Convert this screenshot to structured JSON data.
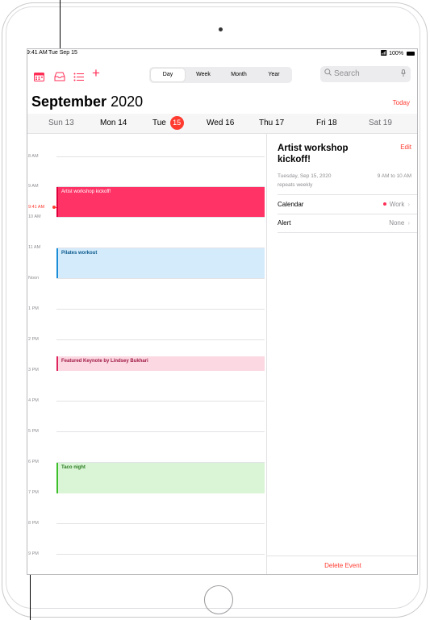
{
  "status": {
    "time": "9:41 AM",
    "date": "Tue Sep 15",
    "battery": "100%"
  },
  "toolbar": {
    "view_tabs": [
      "Day",
      "Week",
      "Month",
      "Year"
    ],
    "active_tab": "Day",
    "search_placeholder": "Search",
    "add_label": "+"
  },
  "header": {
    "month": "September",
    "year": "2020",
    "today_label": "Today"
  },
  "week": [
    {
      "label": "Sun 13"
    },
    {
      "label": "Mon 14"
    },
    {
      "label": "Tue",
      "num": "15"
    },
    {
      "label": "Wed 16"
    },
    {
      "label": "Thu 17"
    },
    {
      "label": "Fri 18"
    },
    {
      "label": "Sat 19"
    }
  ],
  "hours": [
    "8 AM",
    "9 AM",
    "10 AM",
    "11 AM",
    "Noon",
    "1 PM",
    "2 PM",
    "3 PM",
    "4 PM",
    "5 PM",
    "6 PM",
    "7 PM",
    "8 PM",
    "9 PM"
  ],
  "now_label": "9:41 AM",
  "events": [
    {
      "title": "Artist workshop kickoff!"
    },
    {
      "title": "Pilates workout"
    },
    {
      "title": "Featured Keynote by Lindsey Bukhari"
    },
    {
      "title": "Taco night"
    }
  ],
  "detail": {
    "title": "Artist workshop kickoff!",
    "edit_label": "Edit",
    "date": "Tuesday, Sep 15, 2020",
    "time": "9 AM to 10 AM",
    "repeat": "repeats weekly",
    "calendar_label": "Calendar",
    "calendar_value": "Work",
    "alert_label": "Alert",
    "alert_value": "None",
    "delete_label": "Delete Event"
  },
  "colors": {
    "accent": "#ff3b30",
    "brand_pink": "#ff2d55"
  }
}
